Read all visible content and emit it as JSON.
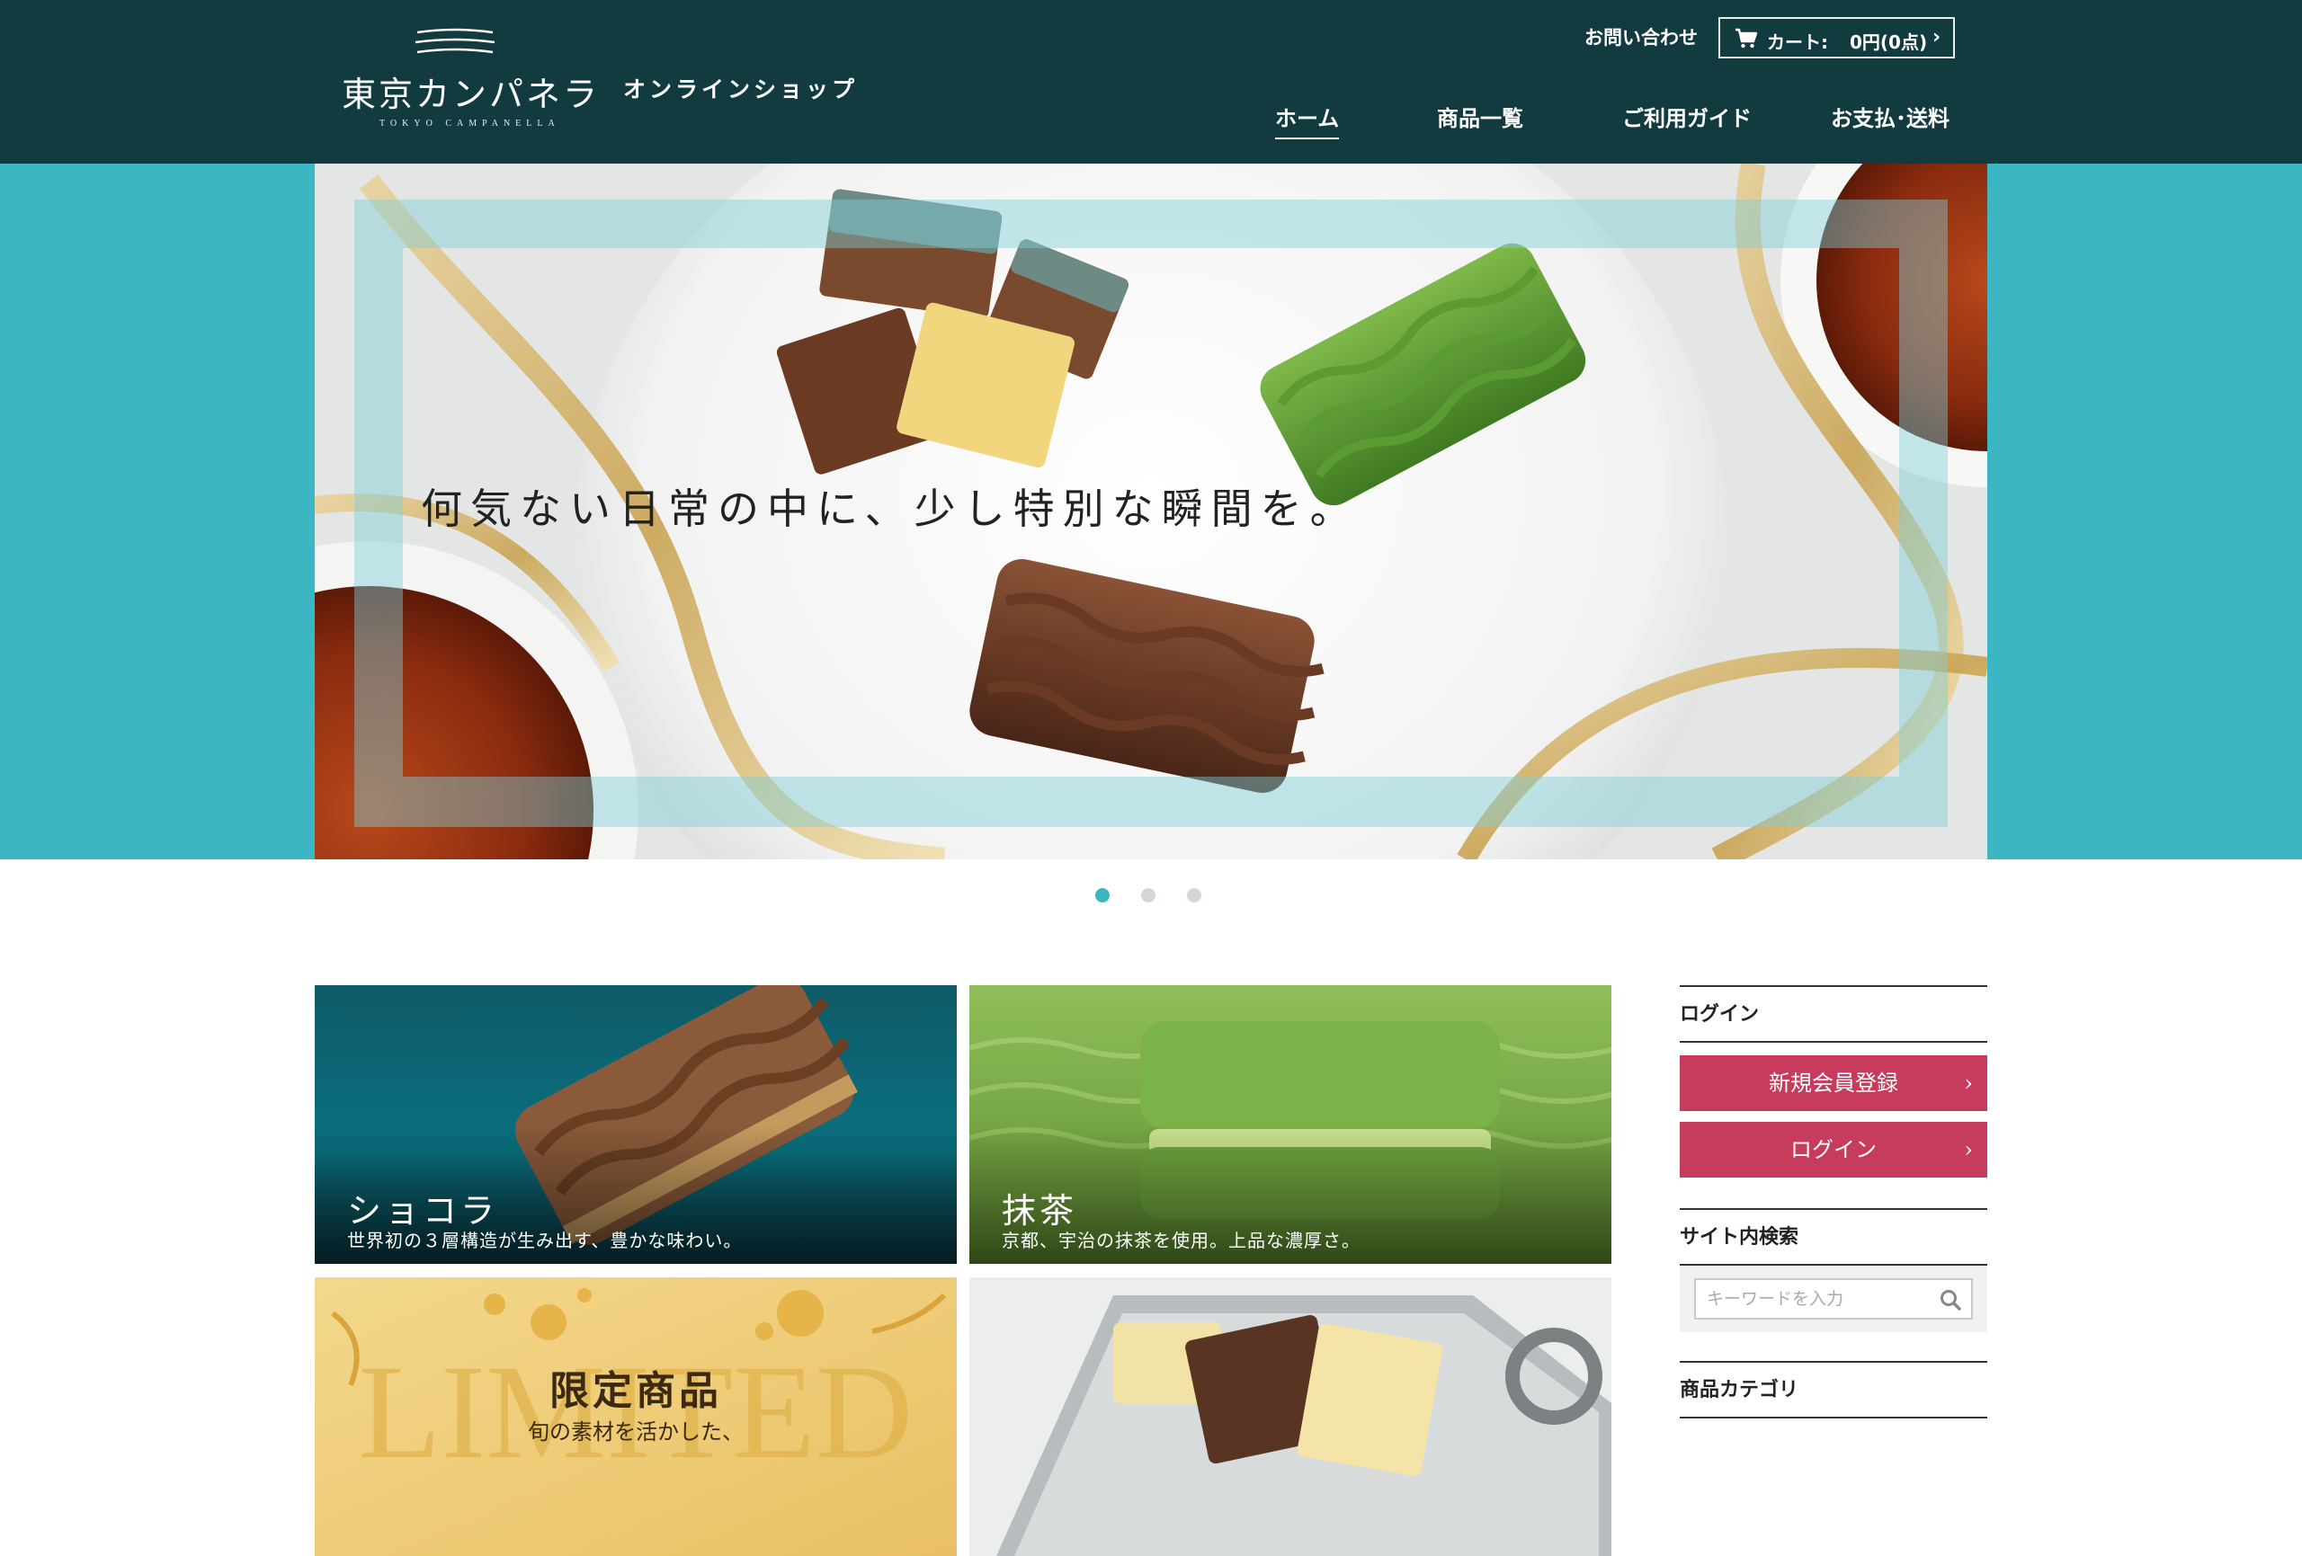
{
  "header": {
    "logo_main": "東京カンパネラ",
    "logo_sub": "TOKYO CAMPANELLA",
    "shop_label": "オンラインショップ",
    "contact_label": "お問い合わせ",
    "cart": {
      "label": "カート:",
      "amount": "0円(0点)",
      "icon": "cart-icon"
    },
    "nav": [
      {
        "label": "ホーム",
        "active": true
      },
      {
        "label": "商品一覧",
        "active": false
      },
      {
        "label": "ご利用ガイド",
        "active": false
      },
      {
        "label": "お支払･送料",
        "active": false
      }
    ]
  },
  "hero": {
    "copy": "何気ない日常の中に、少し特別な瞬間を。",
    "slides_total": 3,
    "active_slide": 1
  },
  "tiles": [
    {
      "title": "ショコラ",
      "desc": "世界初の３層構造が生み出す、豊かな味わい。"
    },
    {
      "title": "抹茶",
      "desc": "京都、宇治の抹茶を使用。上品な濃厚さ。"
    },
    {
      "title": "限定商品",
      "desc": "旬の素材を活かした、",
      "bg_word": "LIMITED"
    },
    {
      "title": "",
      "desc": ""
    }
  ],
  "sidebar": {
    "login_heading": "ログイン",
    "register_button": "新規会員登録",
    "login_button": "ログイン",
    "search_heading": "サイト内検索",
    "search_placeholder": "キーワードを入力",
    "category_heading": "商品カテゴリ"
  },
  "colors": {
    "header_bg": "#123b40",
    "accent_teal": "#3cb6c2",
    "button_red": "#c73c5c"
  }
}
